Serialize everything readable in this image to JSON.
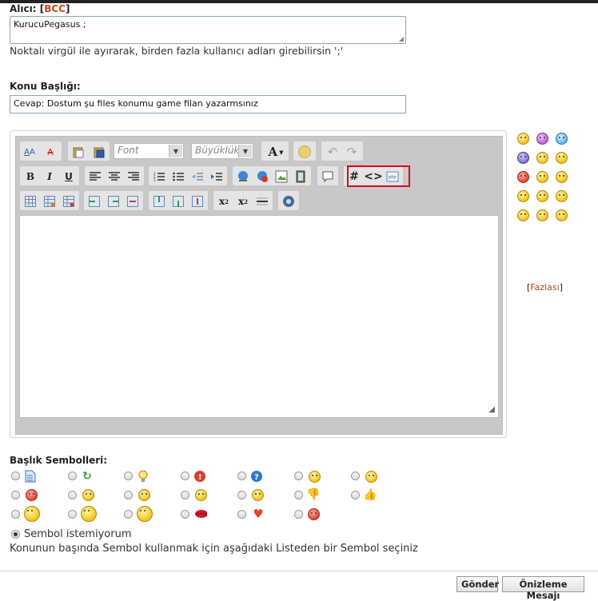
{
  "recipient": {
    "label": "Alıcı:",
    "bcc_label": "BCC",
    "value": "KurucuPegasus ;",
    "hint": "Noktalı virgül ile ayırarak, birden fazla kullanıcı adları girebilirsin ';'"
  },
  "subject": {
    "label": "Konu Başlığı:",
    "value": "Cevap: Dostum şu files konumu game filan yazarmsınız"
  },
  "editor": {
    "font_placeholder": "Font",
    "size_placeholder": "Büyüklük",
    "text_color_label": "A"
  },
  "smilies": {
    "more_link": "Fazlası"
  },
  "symbols": {
    "title": "Başlık Sembolleri:",
    "no_symbol_label": "Sembol istemiyorum",
    "instruction": "Konunun başında Sembol kullanmak için aşağıdaki Listeden bir Sembol seçiniz"
  },
  "actions": {
    "submit_label": "Gönder",
    "preview_label": "Önizleme Mesajı"
  },
  "colors": {
    "highlight": "#e0001b",
    "link": "#b5481b"
  }
}
